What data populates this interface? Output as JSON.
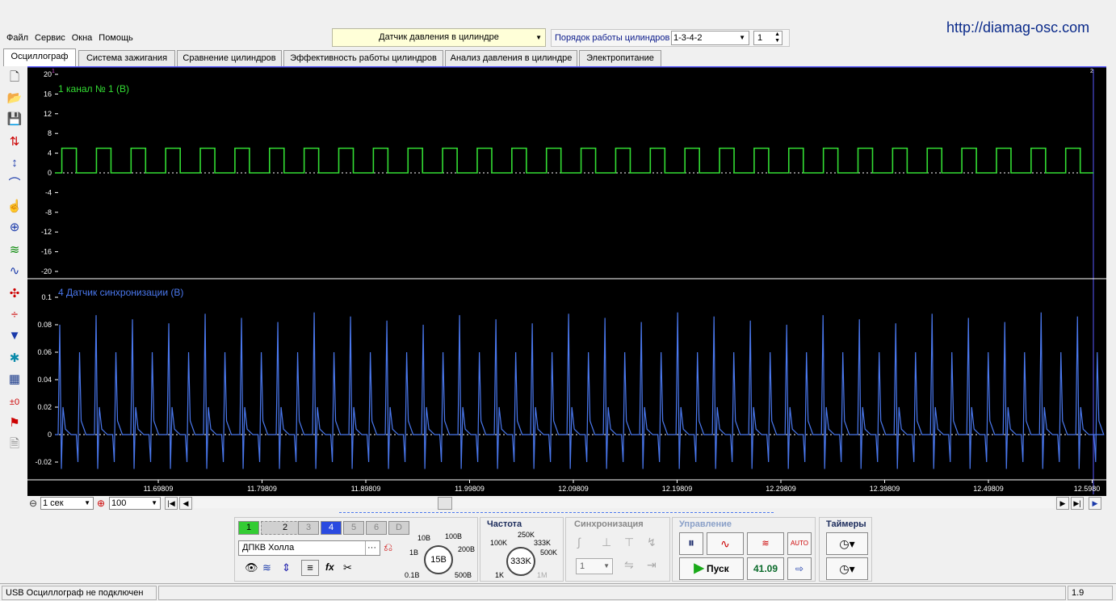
{
  "menu": {
    "items": [
      "Файл",
      "Сервис",
      "Окна",
      "Помощь"
    ]
  },
  "site_link": "http://diamag-osc.com",
  "sensor_select": {
    "value": "Датчик давления в цилиндре"
  },
  "firing_order": {
    "label": "Порядок работы цилиндров",
    "value": "1-3-4-2",
    "cylinder": "1"
  },
  "tabs": [
    "Осциллограф",
    "Система зажигания",
    "Сравнение цилиндров",
    "Эффективность работы цилиндров",
    "Анализ давления в цилиндре",
    "Электропитание"
  ],
  "channel1": {
    "title": "1 канал № 1 (В)",
    "color": "#33dd33",
    "yticks": [
      "20",
      "16",
      "12",
      "8",
      "4",
      "0",
      "-4",
      "-8",
      "-12",
      "-16",
      "-20"
    ],
    "pulse_high": 5,
    "pulse_low": 0,
    "pulse_count": 30
  },
  "channel4": {
    "title": "4 Датчик синхронизации (В)",
    "color": "#4a78ee",
    "yticks": [
      "0.1",
      "0.08",
      "0.06",
      "0.04",
      "0.02",
      "0",
      "-0.02"
    ]
  },
  "xticks": [
    "11.69809",
    "11.79809",
    "11.89809",
    "11.99809",
    "12.09809",
    "12.19809",
    "12.29809",
    "12.39809",
    "12.49809",
    "12.5980"
  ],
  "cursor_markers": [
    "1",
    "2"
  ],
  "timebase": {
    "value": "1 сек",
    "zoom": "100"
  },
  "channels_panel": {
    "buttons": [
      "1",
      "2",
      "3",
      "4",
      "5",
      "6",
      "D"
    ],
    "sensor_name": "ДПКВ Холла",
    "volt_knob": {
      "value": "15В",
      "labels": [
        "10В",
        "100В",
        "1В",
        "200В",
        "0.1В",
        "500В"
      ]
    }
  },
  "freq_panel": {
    "title": "Частота",
    "value": "333K",
    "labels": [
      "250K",
      "100K",
      "333K",
      "500K",
      "1K",
      "1M"
    ]
  },
  "sync_panel": {
    "title": "Синхронизация",
    "value": "1"
  },
  "control_panel": {
    "title": "Управление",
    "start_label": "Пуск",
    "fps": "41.09",
    "auto": "AUTO"
  },
  "timers_panel": {
    "title": "Таймеры"
  },
  "status": {
    "left": "USB Осциллограф не подключен",
    "right": "1.9"
  }
}
